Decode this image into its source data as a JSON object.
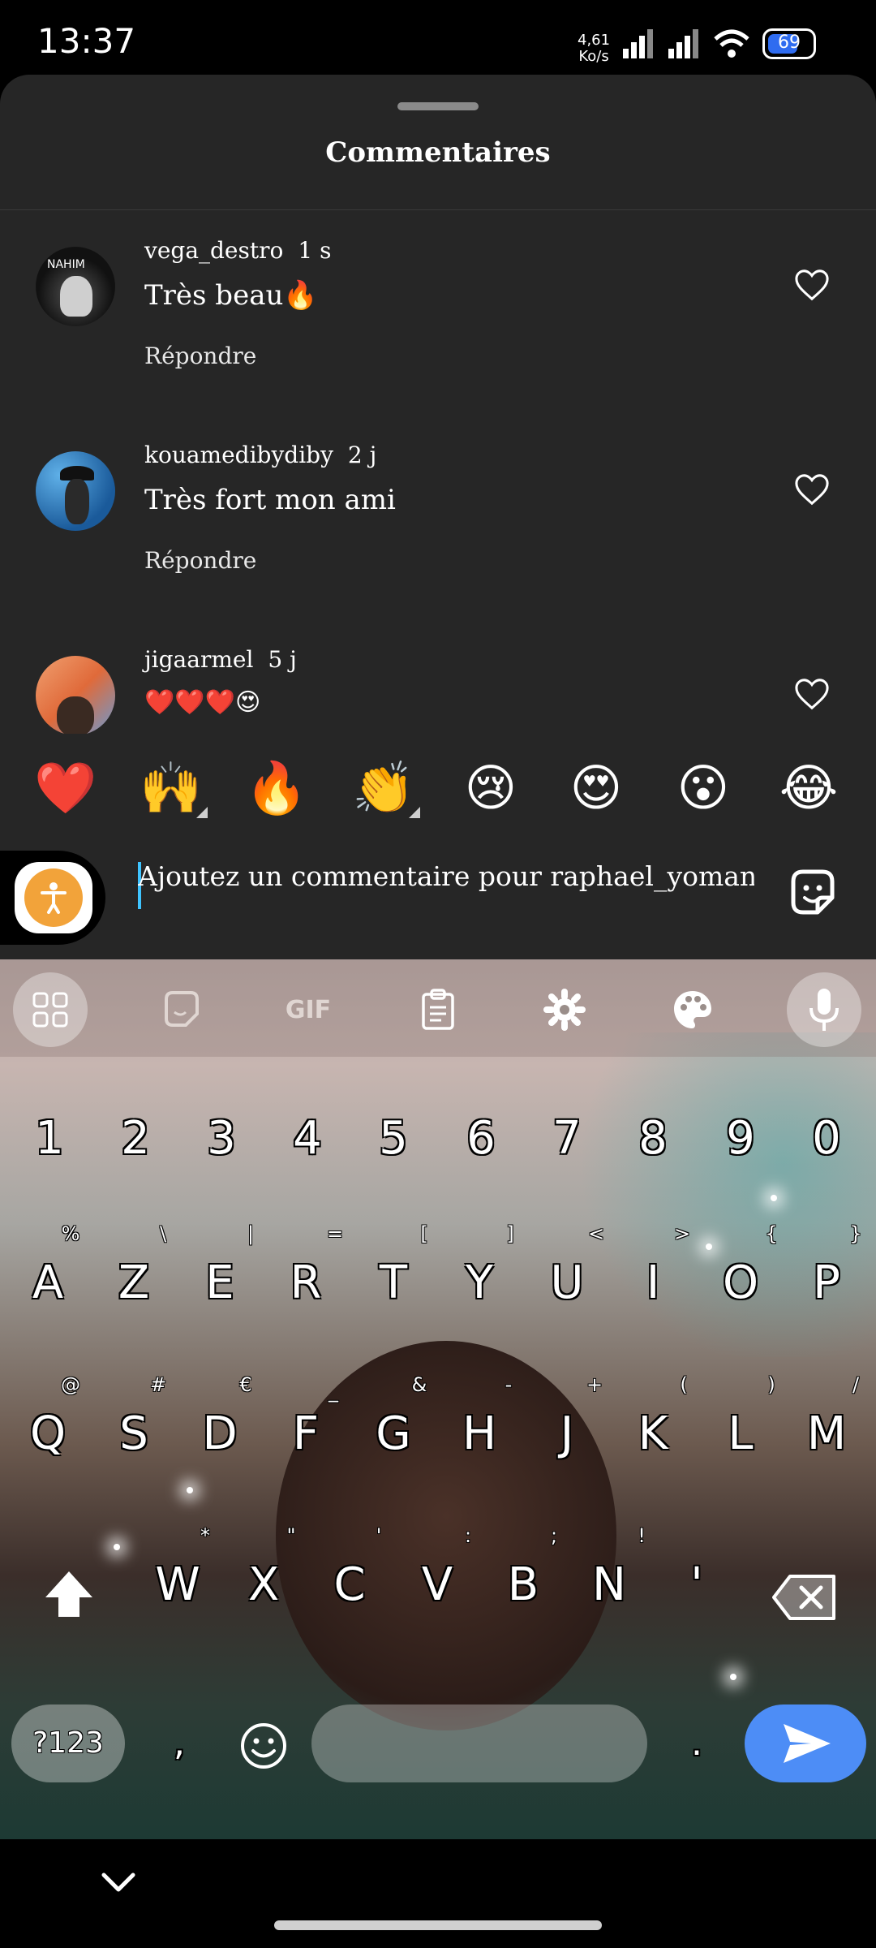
{
  "status_bar": {
    "time": "13:37",
    "speed_value": "4,61",
    "speed_unit": "Ko/s",
    "battery": "69",
    "battery_level": 0.69
  },
  "sheet": {
    "title": "Commentaires"
  },
  "comments": [
    {
      "user": "vega_destro",
      "time": "1 s",
      "text": "Très beau🔥",
      "reply": "Répondre",
      "avatar_label": "NAHIM"
    },
    {
      "user": "kouamedibydiby",
      "time": "2 j",
      "text": "Très fort mon ami",
      "reply": "Répondre"
    },
    {
      "user": "jigaarmel",
      "time": "5 j",
      "text": "❤️❤️❤️😍"
    }
  ],
  "emoji_bar": [
    "❤️",
    "🙌",
    "🔥",
    "👏",
    "😢",
    "😍",
    "😮",
    "😂"
  ],
  "comment_input": {
    "placeholder": "Ajoutez un commentaire pour raphael_yoman_jc..."
  },
  "keyboard": {
    "number_row": [
      "1",
      "2",
      "3",
      "4",
      "5",
      "6",
      "7",
      "8",
      "9",
      "0"
    ],
    "row1": [
      "A",
      "Z",
      "E",
      "R",
      "T",
      "Y",
      "U",
      "I",
      "O",
      "P"
    ],
    "row1_hints": [
      "%",
      "\\",
      "|",
      "=",
      "[",
      "]",
      "<",
      ">",
      "{",
      "}"
    ],
    "row2": [
      "Q",
      "S",
      "D",
      "F",
      "G",
      "H",
      "J",
      "K",
      "L",
      "M"
    ],
    "row2_hints": [
      "@",
      "#",
      "€",
      "_",
      "&",
      "-",
      "+",
      "(",
      ")",
      "/"
    ],
    "row3": [
      "W",
      "X",
      "C",
      "V",
      "B",
      "N",
      "'"
    ],
    "row3_hints": [
      "*",
      "\"",
      "'",
      ":",
      ";",
      "!"
    ],
    "symbols_key": "?123",
    "comma_key": ",",
    "period_key": ".",
    "toolbar_gif": "GIF"
  },
  "colors": {
    "sheet_bg": "#262626",
    "send_key": "#4d8df6",
    "accessibility": "#f2a33a"
  }
}
